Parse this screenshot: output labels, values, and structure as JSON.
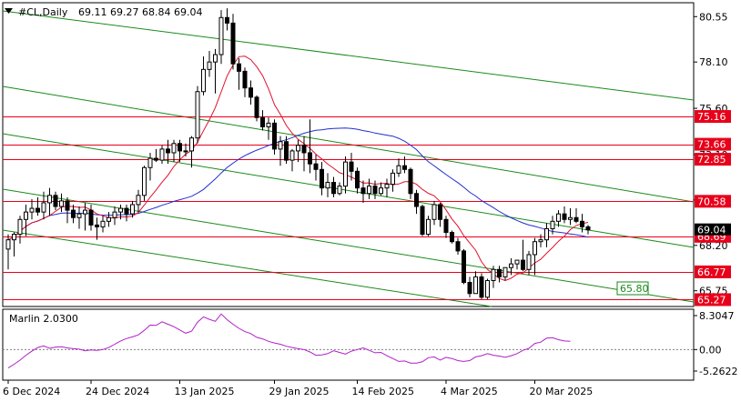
{
  "header": {
    "symbol": "#CL,Daily",
    "ohlc": "69.11 69.27 68.84 69.04"
  },
  "indicator": {
    "name": "Marlin 2.0300",
    "levels": [
      "8.3047",
      "0.00",
      "-5.2622"
    ]
  },
  "colors": {
    "background": "#ffffff",
    "candle": "#000000",
    "ma_fast": "#e0102a",
    "ma_slow": "#1f2fd0",
    "channel": "#1a8a1a",
    "levels": "#e8001a",
    "oscillator": "#b020c8",
    "zero_line": "#808080"
  },
  "chart_data": [
    {
      "type": "candlestick",
      "symbol": "#CL",
      "timeframe": "Daily",
      "x_tick_labels": [
        "6 Dec 2024",
        "24 Dec 2024",
        "13 Jan 2025",
        "29 Jan 2025",
        "14 Feb 2025",
        "4 Mar 2025",
        "20 Mar 2025"
      ],
      "y_tick_labels": [
        "80.55",
        "78.10",
        "75.60",
        "73.10",
        "70.65",
        "68.20",
        "65.75"
      ],
      "ylim": [
        64.9,
        81.3
      ],
      "last_price": "69.04",
      "price_levels": [
        "75.16",
        "73.66",
        "72.85",
        "70.58",
        "68.69",
        "66.77",
        "65.27"
      ],
      "channel_label": "65.80",
      "series": [
        {
          "name": "OHLC",
          "open": [
            68.0,
            68.5,
            68.8,
            69.6,
            70.0,
            70.2,
            70.0,
            70.5,
            70.9,
            70.3,
            70.6,
            70.1,
            69.7,
            69.9,
            70.1,
            69.3,
            69.2,
            69.5,
            69.7,
            70.0,
            70.2,
            69.9,
            70.4,
            70.9,
            72.4,
            72.9,
            72.8,
            73.4,
            73.2,
            73.7,
            73.3,
            73.3,
            74.0,
            76.5,
            77.7,
            78.1,
            78.5,
            80.5,
            80.2,
            78.0,
            77.6,
            76.7,
            76.2,
            75.1,
            74.6,
            74.8,
            73.4,
            73.8,
            72.8,
            73.3,
            73.6,
            73.2,
            72.6,
            72.3,
            71.3,
            71.6,
            71.0,
            71.4,
            72.7,
            72.2,
            71.3,
            71.0,
            71.4,
            71.0,
            71.3,
            71.5,
            72.1,
            72.5,
            72.3,
            71.0,
            70.3,
            68.8,
            69.6,
            70.4,
            69.6,
            68.9,
            68.4,
            67.9,
            66.2,
            65.6,
            66.5,
            65.4,
            66.3,
            66.9,
            66.5,
            67.0,
            67.2,
            67.4,
            66.9,
            67.7,
            68.4,
            68.5,
            69.1,
            69.5,
            69.9,
            69.6,
            69.7,
            69.5,
            69.2
          ],
          "high": [
            68.8,
            68.9,
            69.8,
            70.4,
            70.7,
            70.8,
            71.1,
            71.3,
            71.1,
            71.0,
            70.8,
            70.4,
            70.3,
            70.5,
            70.4,
            69.7,
            69.8,
            70.0,
            70.3,
            70.4,
            70.4,
            70.6,
            71.2,
            72.5,
            73.2,
            73.4,
            73.6,
            73.9,
            73.9,
            73.9,
            73.7,
            74.1,
            76.8,
            78.4,
            78.7,
            78.8,
            80.9,
            81.0,
            80.7,
            78.3,
            77.8,
            77.1,
            76.3,
            75.5,
            75.1,
            75.0,
            74.1,
            74.1,
            73.4,
            73.9,
            74.1,
            75.0,
            73.1,
            72.7,
            72.1,
            71.9,
            71.6,
            73.0,
            73.2,
            72.4,
            71.7,
            71.8,
            71.7,
            71.6,
            71.8,
            72.3,
            72.9,
            73.0,
            72.4,
            71.2,
            70.4,
            69.8,
            70.6,
            70.5,
            69.8,
            69.0,
            68.6,
            68.0,
            66.5,
            66.8,
            66.7,
            66.4,
            67.1,
            67.1,
            67.0,
            67.5,
            67.4,
            68.5,
            67.9,
            68.6,
            68.8,
            69.4,
            69.8,
            70.1,
            70.3,
            70.2,
            70.2,
            69.9,
            69.3
          ],
          "low": [
            66.9,
            67.6,
            68.3,
            68.7,
            69.6,
            69.8,
            69.6,
            69.8,
            70.1,
            70.0,
            69.4,
            69.4,
            69.1,
            69.0,
            69.0,
            68.5,
            68.9,
            69.2,
            69.3,
            69.6,
            69.5,
            69.7,
            70.0,
            70.6,
            71.7,
            72.7,
            72.6,
            72.6,
            72.7,
            72.7,
            73.0,
            72.4,
            73.7,
            76.3,
            77.3,
            76.4,
            78.0,
            79.8,
            77.7,
            76.6,
            76.2,
            75.8,
            74.9,
            74.4,
            73.9,
            73.1,
            72.5,
            72.6,
            72.2,
            72.7,
            72.2,
            72.1,
            71.7,
            70.9,
            70.8,
            70.8,
            70.9,
            71.0,
            71.7,
            71.0,
            70.5,
            70.7,
            70.7,
            70.9,
            70.8,
            71.1,
            71.9,
            72.1,
            70.7,
            69.9,
            68.7,
            68.7,
            69.3,
            69.2,
            68.6,
            68.3,
            67.7,
            66.1,
            65.4,
            65.6,
            65.3,
            65.3,
            65.9,
            66.2,
            66.3,
            66.6,
            66.9,
            66.8,
            66.6,
            66.6,
            68.1,
            68.1,
            68.8,
            69.2,
            69.4,
            69.3,
            69.4,
            68.9,
            68.8
          ],
          "close": [
            68.5,
            68.8,
            69.6,
            70.0,
            70.2,
            70.0,
            70.5,
            70.9,
            70.3,
            70.6,
            70.1,
            69.7,
            69.9,
            70.1,
            69.3,
            69.2,
            69.5,
            69.7,
            70.0,
            70.2,
            69.9,
            70.4,
            70.9,
            72.4,
            72.9,
            72.8,
            73.4,
            73.2,
            73.7,
            73.3,
            73.3,
            74.0,
            76.5,
            77.7,
            78.1,
            78.5,
            80.5,
            80.2,
            78.0,
            77.6,
            76.7,
            76.2,
            75.1,
            74.6,
            74.8,
            73.4,
            73.8,
            72.8,
            73.3,
            73.6,
            73.2,
            72.6,
            72.3,
            71.3,
            71.6,
            71.0,
            71.4,
            72.7,
            72.2,
            71.3,
            71.0,
            71.4,
            71.0,
            71.3,
            71.5,
            72.1,
            72.5,
            72.3,
            71.0,
            70.3,
            68.8,
            69.6,
            70.4,
            69.6,
            68.9,
            68.4,
            67.9,
            66.2,
            65.6,
            66.5,
            65.4,
            66.3,
            66.9,
            66.5,
            67.0,
            67.2,
            67.4,
            66.9,
            67.7,
            68.4,
            68.5,
            69.1,
            69.5,
            69.9,
            69.6,
            69.7,
            69.5,
            69.2,
            69.04
          ]
        }
      ]
    },
    {
      "type": "line",
      "name": "Marlin 2.0300",
      "ylim": [
        -5.2622,
        8.3047
      ],
      "y_tick_labels": [
        "8.3047",
        "0.00",
        "-5.2622"
      ],
      "series": [
        {
          "name": "Marlin 2.0300",
          "values": [
            -4.5,
            -3.6,
            -2.6,
            -1.4,
            -0.4,
            0.5,
            0.9,
            0.3,
            0.6,
            0.7,
            0.4,
            0.2,
            0.1,
            -0.3,
            -0.1,
            -0.2,
            0.0,
            0.5,
            1.3,
            2.1,
            2.7,
            3.1,
            3.6,
            4.7,
            6.0,
            5.9,
            6.8,
            6.2,
            5.6,
            4.8,
            4.0,
            4.5,
            6.7,
            8.0,
            7.4,
            6.9,
            8.7,
            7.3,
            6.2,
            5.2,
            4.4,
            3.9,
            3.0,
            2.6,
            2.0,
            1.6,
            1.3,
            0.8,
            0.5,
            0.2,
            0.0,
            -0.6,
            -1.4,
            -1.3,
            -1.0,
            -0.3,
            -0.7,
            -1.1,
            -0.4,
            0.0,
            0.4,
            -0.2,
            -0.8,
            -0.7,
            -1.5,
            -2.2,
            -2.9,
            -2.8,
            -3.3,
            -3.3,
            -3.0,
            -2.0,
            -1.8,
            -2.6,
            -1.9,
            -2.2,
            -2.7,
            -2.9,
            -2.7,
            -1.8,
            -1.5,
            -1.0,
            -1.4,
            -1.6,
            -1.9,
            -1.5,
            -1.0,
            -0.2,
            0.3,
            1.5,
            1.8,
            2.8,
            2.9,
            2.4,
            2.1,
            2.0
          ]
        }
      ]
    }
  ]
}
